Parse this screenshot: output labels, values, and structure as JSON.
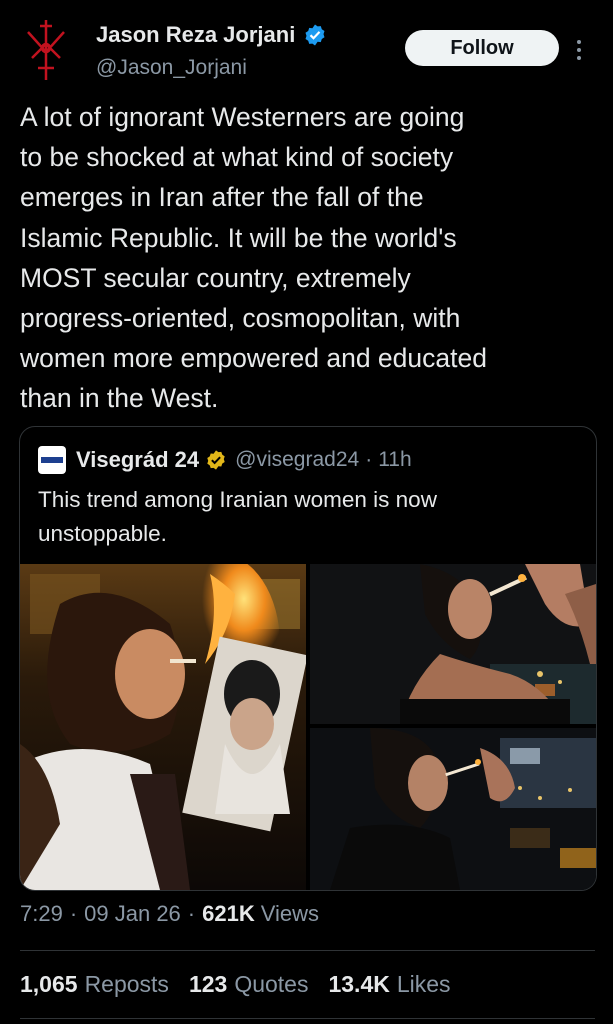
{
  "author": {
    "display_name": "Jason Reza Jorjani",
    "handle": "@Jason_Jorjani",
    "verified_icon": "verified-badge-icon",
    "avatar_icon": "red-sigil-icon"
  },
  "follow_label": "Follow",
  "more_icon": "more-vertical-icon",
  "tweet_text": "A lot of ignorant Westerners are going\nto be shocked at what kind of society\nemerges in Iran after the fall of the\nIslamic Republic. It will be the world's\nMOST secular country, extremely\nprogress-oriented, cosmopolitan, with\nwomen more empowered and educated\nthan in the West.",
  "quote": {
    "display_name": "Visegrád 24",
    "handle": "@visegrad24",
    "dot": "·",
    "time": "11h",
    "text": "This trend among Iranian women is now\nunstoppable.",
    "verified_icon": "gold-verified-badge-icon",
    "media": [
      "photo-woman-burning-portrait",
      "photo-woman-lighting-cigarette",
      "photo-woman-lighting-cigarette-night"
    ]
  },
  "meta": {
    "time": "7:29",
    "sep1": "·",
    "date": "09 Jan 26",
    "sep2": "·",
    "views_count": "621K",
    "views_label": "Views"
  },
  "stats": {
    "reposts_count": "1,065",
    "reposts_label": "Reposts",
    "quotes_count": "123",
    "quotes_label": "Quotes",
    "likes_count": "13.4K",
    "likes_label": "Likes"
  },
  "colors": {
    "background": "#000000",
    "text": "#e7e9ea",
    "secondary_text": "#8b98a5",
    "verified_blue": "#1d9bf0",
    "verified_gold": "#e2b719",
    "border": "#2f3336"
  }
}
